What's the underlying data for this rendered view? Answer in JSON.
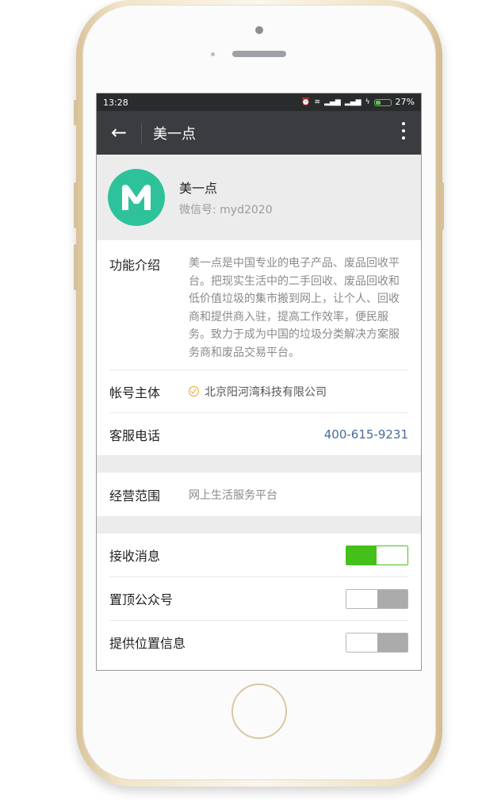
{
  "status_bar": {
    "time": "13:28",
    "battery": "27%"
  },
  "app_bar": {
    "title": "美一点"
  },
  "account": {
    "name": "美一点",
    "wechat_id": "微信号: myd2020"
  },
  "intro": {
    "label": "功能介绍",
    "text": "美一点是中国专业的电子产品、废品回收平台。把现实生活中的二手回收、废品回收和低价值垃圾的集市搬到网上，让个人、回收商和提供商入驻，提高工作效率，便民服务。致力于成为中国的垃圾分类解决方案服务商和废品交易平台。"
  },
  "subject": {
    "label": "帐号主体",
    "value": "北京阳河湾科技有限公司"
  },
  "service": {
    "label": "客服电话",
    "value": "400-615-9231"
  },
  "scope": {
    "label": "经营范围",
    "value": "网上生活服务平台"
  },
  "settings": [
    {
      "label": "接收消息",
      "state": "on"
    },
    {
      "label": "置顶公众号",
      "state": "off"
    },
    {
      "label": "提供位置信息",
      "state": "off"
    }
  ],
  "colors": {
    "accent_green": "#45c01a",
    "logo_teal": "#2ec29b",
    "link_blue": "#4a6b9a"
  }
}
